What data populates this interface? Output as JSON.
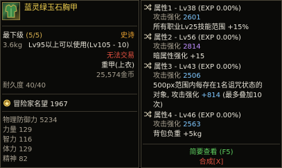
{
  "item": {
    "name": "蓝灵绿玉石胸甲",
    "grade_label": "最下级",
    "grade_value": "(5/5)",
    "rarity": "史诗",
    "weight": "3.6kg",
    "requirement": "Lv95以上可以使用(Lv105 - 10)",
    "trade": "无法交易",
    "armor_type": "重甲(上衣)",
    "price": "25,574金币",
    "durability": "耐久度 40/40",
    "fame_label": "冒险家名望",
    "fame_value": "1967",
    "stats": [
      {
        "label": "物理防御力",
        "value": "5234"
      },
      {
        "label": "力量",
        "value": "129"
      },
      {
        "label": "智力",
        "value": "116"
      },
      {
        "label": "体力",
        "value": "129"
      },
      {
        "label": "精神",
        "value": "82"
      }
    ]
  },
  "attributes": [
    {
      "title": "属性1 - Lv38 (EXP 0.00%)",
      "boost_label": "攻击强化",
      "boost_value": "2601",
      "line1": "所有职业Lv25技能范围 +15%"
    },
    {
      "title": "属性2 - Lv56 (EXP 0.00%)",
      "boost_label": "攻击强化",
      "boost_value": "2814",
      "line1": "暗属性强化 +15"
    },
    {
      "title": "属性3 - Lv43 (EXP 0.00%)",
      "boost_label": "攻击强化",
      "boost_value": "2506",
      "line1": "500px范围内每存在1名诅咒状态的",
      "line2a": "对象, 攻击强化",
      "line2b": "+814",
      "line2c": "(最多叠加10",
      "line3": "次)"
    },
    {
      "title": "属性4 - Lv46 (EXP 0.00%)",
      "boost_label": "攻击强化",
      "boost_value": "2563",
      "line1": "背包负重 +5kg"
    }
  ],
  "footer": {
    "simple_view": "简要查看 (F5)",
    "compose": "合成[X]"
  }
}
